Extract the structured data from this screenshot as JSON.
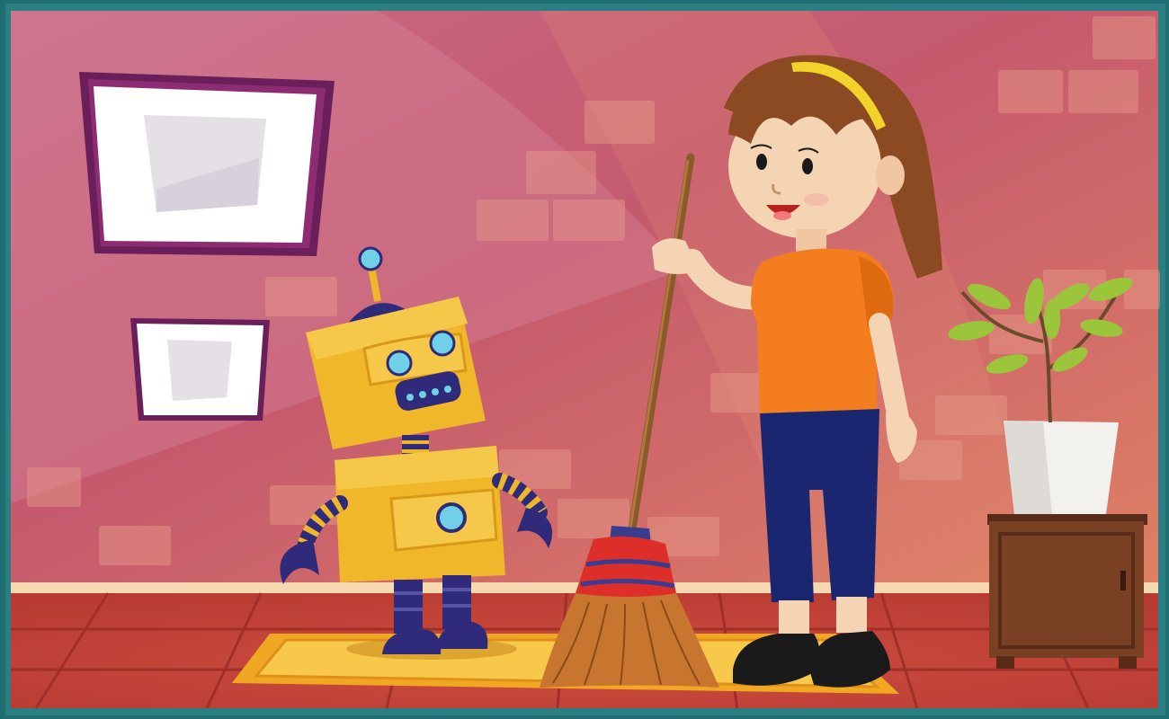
{
  "scene": {
    "subjects": [
      "girl",
      "robot",
      "broom",
      "potted-plant",
      "cabinet",
      "picture-frames",
      "rug"
    ]
  },
  "colors": {
    "border_teal": "#1f6e72",
    "wall_top": "#c65a78",
    "wall_bottom": "#dc7763",
    "wall_highlight": "#d77f95",
    "wall_bricks": "#e68f7f",
    "baseboard": "#f3d2a6",
    "floor": "#c4453a",
    "floor_lines": "#9f2f28",
    "rug": "#f3b129",
    "rug_inner": "#f8c84a",
    "robot_yellow": "#f0b72b",
    "robot_shade": "#d99817",
    "robot_navy": "#2f2a7a",
    "robot_eyes": "#6fd0e8",
    "shirt": "#f47e1f",
    "pants": "#1a2670",
    "hair": "#8c4a22",
    "headband": "#f2d32a",
    "skin": "#f5d4b4",
    "shoes": "#1a1a1a",
    "broom_head": "#c8752f",
    "broom_band": "#dd2e2a",
    "broom_stripe": "#3a3d8f",
    "broom_handle": "#8a5a2b",
    "pot": "#f3f1ee",
    "leaves": "#9bc63b",
    "cabinet": "#7a4024",
    "cabinet_frame": "#5a2c17",
    "frame": "#6b1f5a",
    "frame_mat": "#ffffff",
    "frame_art": "#e6e2e8"
  }
}
